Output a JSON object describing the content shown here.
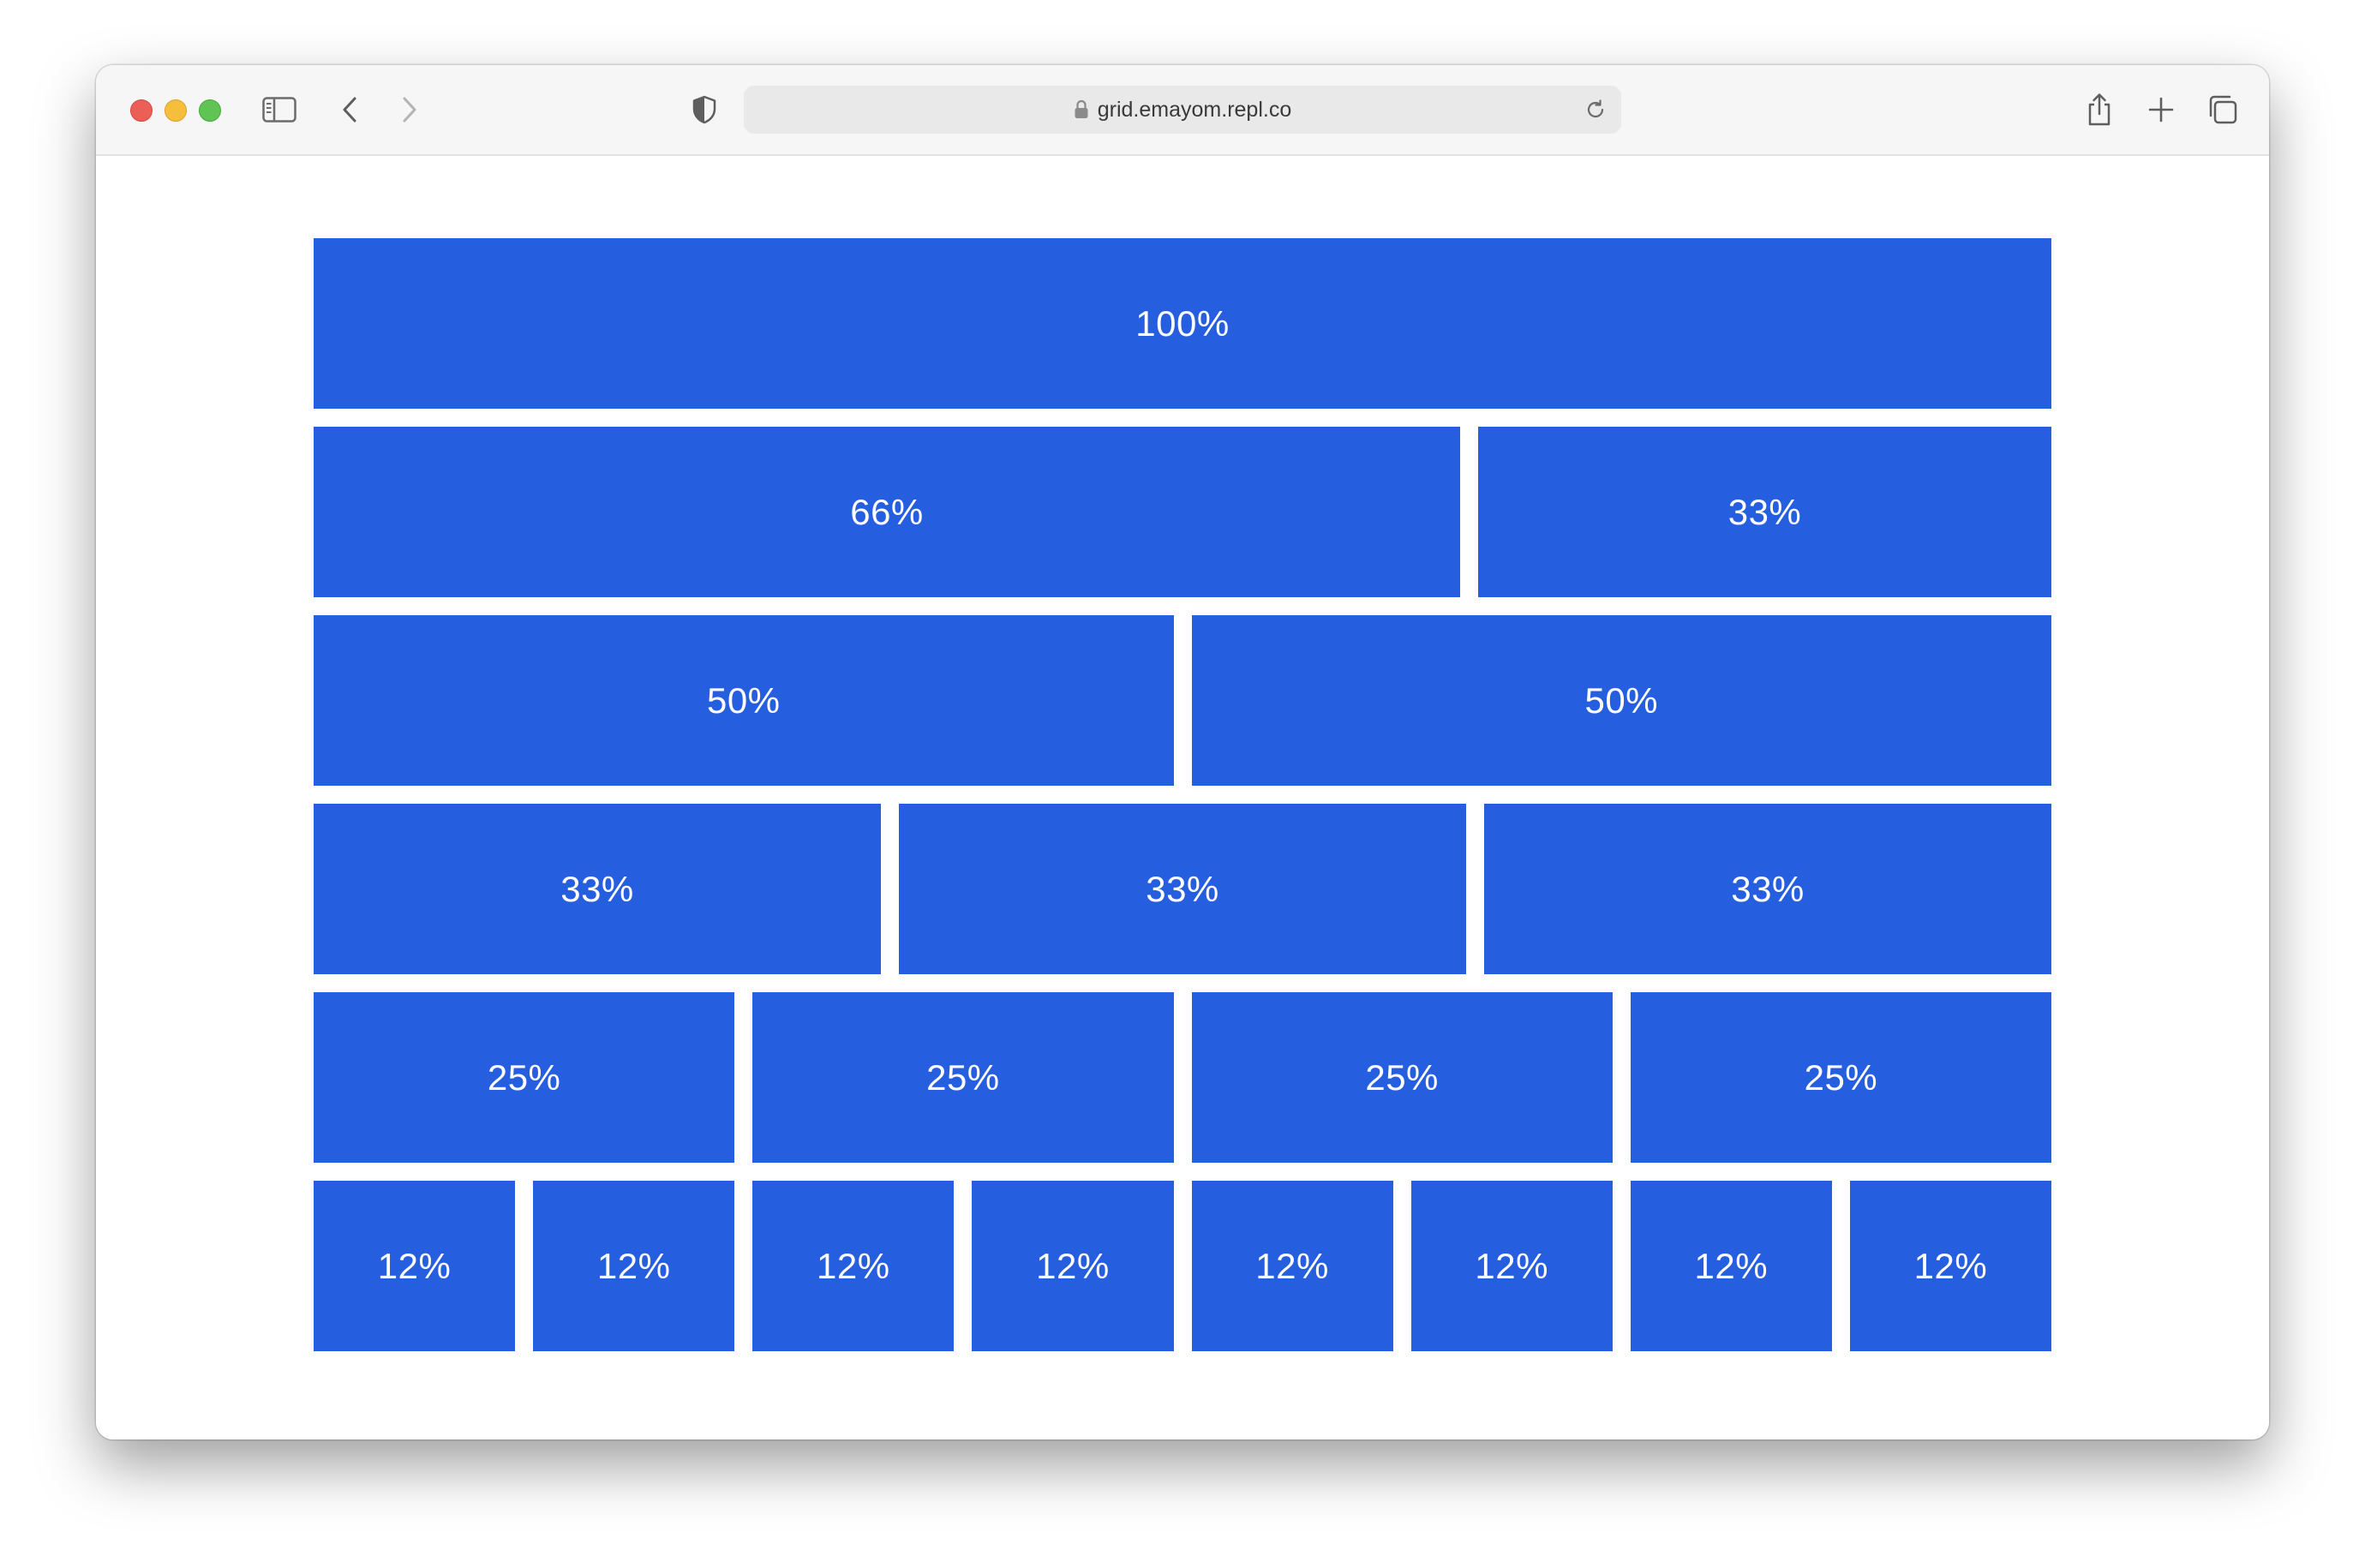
{
  "browser": {
    "url": "grid.emayom.repl.co",
    "icons": {
      "sidebar": "sidebar-icon",
      "back": "chevron-left-icon",
      "forward": "chevron-right-icon",
      "privacy": "shield-icon",
      "lock": "lock-icon",
      "reload": "reload-icon",
      "share": "share-icon",
      "new_tab": "plus-icon",
      "tabs": "tabs-overview-icon"
    }
  },
  "grid": {
    "cell_color": "#265ee0",
    "rows": [
      {
        "cells": [
          {
            "label": "100%",
            "span": 12
          }
        ]
      },
      {
        "cells": [
          {
            "label": "66%",
            "span": 8
          },
          {
            "label": "33%",
            "span": 4
          }
        ]
      },
      {
        "cells": [
          {
            "label": "50%",
            "span": 6
          },
          {
            "label": "50%",
            "span": 6
          }
        ]
      },
      {
        "cells": [
          {
            "label": "33%",
            "span": 4
          },
          {
            "label": "33%",
            "span": 4
          },
          {
            "label": "33%",
            "span": 4
          }
        ]
      },
      {
        "cells": [
          {
            "label": "25%",
            "span": 3
          },
          {
            "label": "25%",
            "span": 3
          },
          {
            "label": "25%",
            "span": 3
          },
          {
            "label": "25%",
            "span": 3
          }
        ]
      },
      {
        "cells": [
          {
            "label": "12%",
            "span": 1
          },
          {
            "label": "12%",
            "span": 1
          },
          {
            "label": "12%",
            "span": 1
          },
          {
            "label": "12%",
            "span": 1
          },
          {
            "label": "12%",
            "span": 1
          },
          {
            "label": "12%",
            "span": 1
          },
          {
            "label": "12%",
            "span": 1
          },
          {
            "label": "12%",
            "span": 1
          }
        ]
      }
    ]
  }
}
